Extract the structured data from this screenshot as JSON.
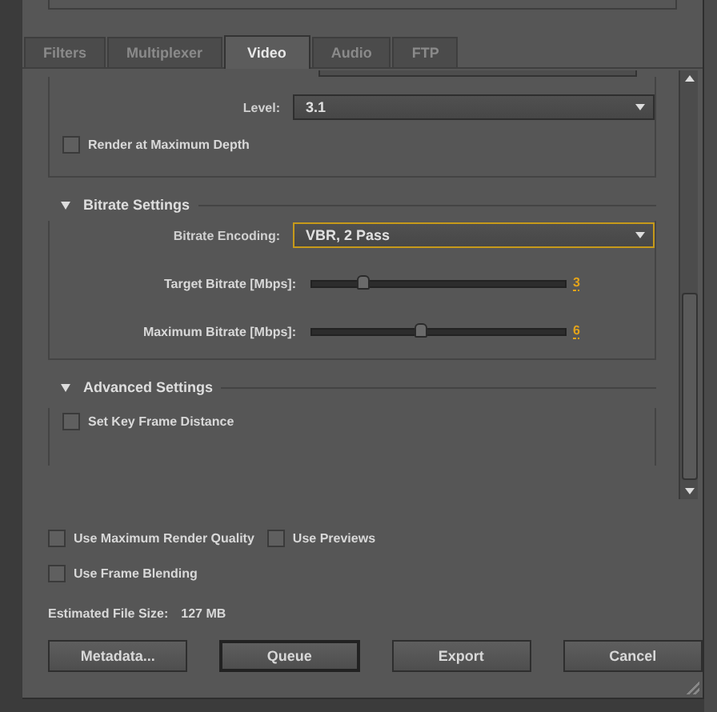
{
  "tabs": [
    {
      "label": "Filters",
      "selected": false
    },
    {
      "label": "Multiplexer",
      "selected": false
    },
    {
      "label": "Video",
      "selected": true
    },
    {
      "label": "Audio",
      "selected": false
    },
    {
      "label": "FTP",
      "selected": false
    }
  ],
  "basic": {
    "level": {
      "label": "Level:",
      "value": "3.1"
    },
    "checkbox": {
      "label": "Render at Maximum Depth",
      "checked": false
    }
  },
  "bitrate_settings": {
    "title": "Bitrate Settings",
    "expanded": true,
    "encoding": {
      "label": "Bitrate Encoding:",
      "value": "VBR, 2 Pass",
      "focused": true
    },
    "sliders": [
      {
        "label": "Target Bitrate [Mbps]:",
        "level": 0.2,
        "reading": "3"
      },
      {
        "label": "Maximum Bitrate [Mbps]:",
        "level": 0.43,
        "reading": "6"
      }
    ]
  },
  "advanced_settings": {
    "title": "Advanced Settings",
    "expanded": true,
    "checkboxes": [
      {
        "label": "Set Key Frame Distance",
        "checked": false
      }
    ]
  },
  "option_rows": [
    [
      {
        "label": "Use Maximum Render Quality",
        "checked": false
      },
      {
        "label": "Use Previews",
        "checked": false
      }
    ],
    [
      {
        "label": "Use Frame Blending",
        "checked": false
      }
    ]
  ],
  "estimated_file_size": {
    "label": "Estimated File Size:",
    "value": "127 MB"
  },
  "buttons": [
    {
      "label": "Metadata...",
      "default": false
    },
    {
      "label": "Queue",
      "default": true
    },
    {
      "label": "Export",
      "default": false
    },
    {
      "label": "Cancel",
      "default": false
    }
  ]
}
